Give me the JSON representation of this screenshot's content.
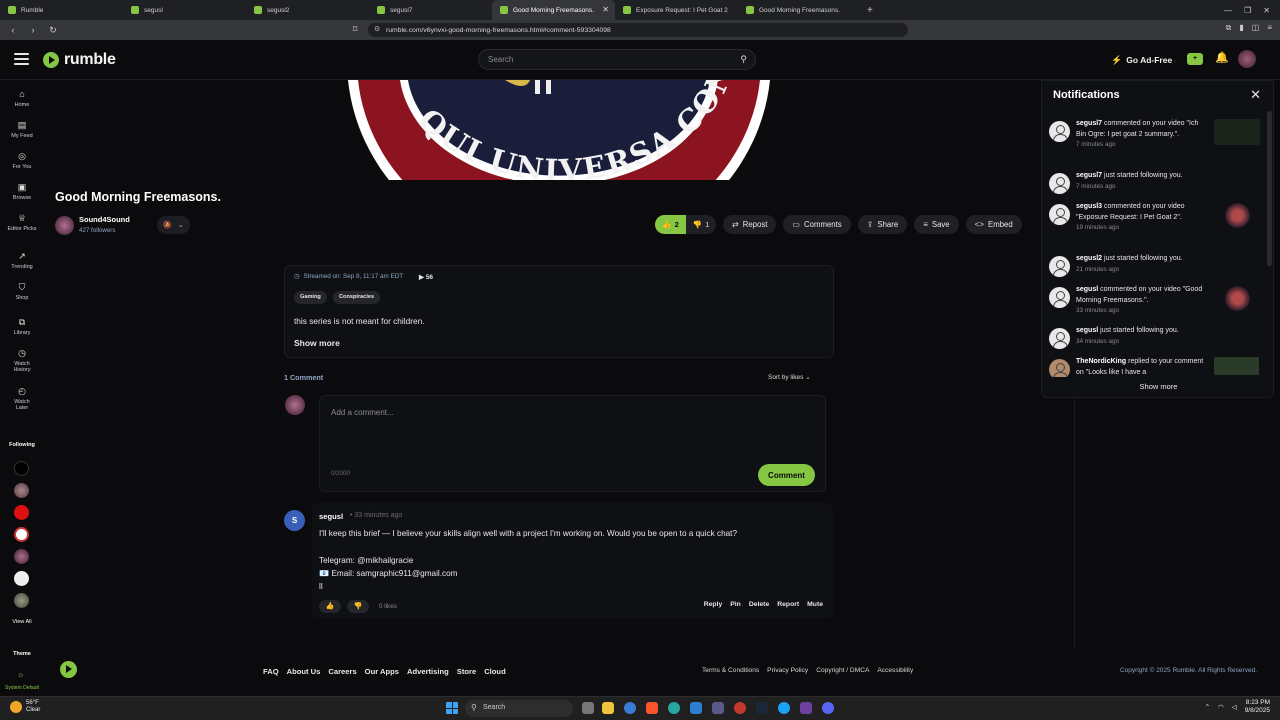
{
  "browser": {
    "tabs": [
      {
        "label": "Rumble"
      },
      {
        "label": "segusl"
      },
      {
        "label": "segusl2"
      },
      {
        "label": "segusl7"
      },
      {
        "label": "Good Morning Freemasons.",
        "active": true
      },
      {
        "label": "Exposure Request: I Pet Goat 2"
      },
      {
        "label": "Good Morning Freemasons."
      }
    ],
    "url": "rumble.com/v6ynvxi-good-morning-freemasons.html#comment-593304098"
  },
  "header": {
    "logo_text": "rumble",
    "search_placeholder": "Search",
    "go_ad_free": "Go Ad-Free"
  },
  "sidebar": {
    "items": [
      {
        "label": "Home",
        "icon": "home-icon"
      },
      {
        "label": "My Feed",
        "icon": "feed-icon"
      },
      {
        "label": "For You",
        "icon": "target-icon"
      },
      {
        "label": "Browse",
        "icon": "browse-icon"
      },
      {
        "label": "Editor Picks",
        "icon": "trophy-icon"
      },
      {
        "label": "Trending",
        "icon": "trending-icon"
      },
      {
        "label": "Shop",
        "icon": "shop-icon"
      },
      {
        "label": "Library",
        "icon": "library-icon"
      },
      {
        "label": "Watch History",
        "icon": "history-icon"
      },
      {
        "label": "Watch Later",
        "icon": "clock-icon"
      }
    ],
    "following_label": "Following",
    "view_all": "View All",
    "theme_label": "Theme",
    "theme_value": "System Default"
  },
  "video": {
    "title": "Good Morning Freemasons.",
    "art_text": "QUI UNIVERSA CONS",
    "channel_name": "Sound4Sound",
    "followers": "427 followers",
    "likes": "2",
    "dislikes": "1",
    "actions": {
      "repost": "Repost",
      "comments": "Comments",
      "share": "Share",
      "save": "Save",
      "embed": "Embed"
    },
    "streamed": "Streamed on: Sep 8, 11:17 am EDT",
    "views": "56",
    "tags": [
      "Gaming",
      "Conspiracies"
    ],
    "description": "this series is not meant for children.",
    "show_more": "Show more"
  },
  "comments": {
    "count_label": "1 Comment",
    "sort_label": "Sort by likes",
    "input_placeholder": "Add a comment...",
    "char_count": "0/2000",
    "submit_label": "Comment",
    "items": [
      {
        "avatar_letter": "S",
        "user": "segusl",
        "time": "33 minutes ago",
        "lines": [
          "I'll keep this brief — I believe your skills align well with a project I'm working on. Would you be open to a quick chat?",
          "Telegram: @mikhailgracie",
          "📧 Email: samgraphic911@gmail.com",
          "ll"
        ],
        "likes": "0 likes",
        "actions": [
          "Reply",
          "Pin",
          "Delete",
          "Report",
          "Mute"
        ]
      }
    ]
  },
  "notifications": {
    "title": "Notifications",
    "items": [
      {
        "user": "segusl7",
        "text": "commented on your video \"Ich Bin Ogre: I pet goat 2 summary.\".",
        "time": "7 minutes ago"
      },
      {
        "user": "segusl7",
        "text": "just started following you.",
        "time": "7 minutes ago"
      },
      {
        "user": "segusl3",
        "text": "commented on your video \"Exposure Request: I Pet Goat 2\".",
        "time": "19 minutes ago"
      },
      {
        "user": "segusl2",
        "text": "just started following you.",
        "time": "21 minutes ago"
      },
      {
        "user": "segusl",
        "text": "commented on your video \"Good Morning Freemasons.\".",
        "time": "33 minutes ago"
      },
      {
        "user": "segusl",
        "text": "just started following you.",
        "time": "34 minutes ago"
      },
      {
        "user": "TheNordicKing",
        "text": "replied to your comment on \"Looks like I have a",
        "time": ""
      }
    ],
    "show_more": "Show more"
  },
  "footer": {
    "links": [
      "FAQ",
      "About Us",
      "Careers",
      "Our Apps",
      "Advertising",
      "Store",
      "Cloud"
    ],
    "legal": [
      "Terms & Conditions",
      "Privacy Policy",
      "Copyright / DMCA",
      "Accessibility"
    ],
    "copyright": "Copyright © 2025 Rumble. All Rights Reserved."
  },
  "taskbar": {
    "temp": "56°F",
    "condition": "Clear",
    "search": "Search",
    "time": "8:23 PM",
    "date": "9/8/2025"
  },
  "colors": {
    "accent": "#85c742",
    "background": "#0b0b0e",
    "panel": "#0f1013"
  }
}
